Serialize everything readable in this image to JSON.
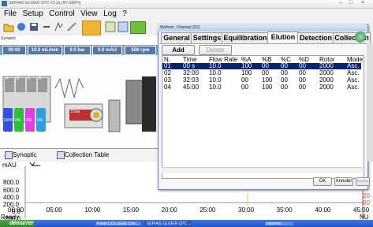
{
  "window": {
    "title": "SEPIAlS GLIDER CPC V3.2a (IFI-SEPH)"
  },
  "menu": [
    "File",
    "Setup",
    "Control",
    "View",
    "Log",
    "?"
  ],
  "synoptic": {
    "label": "Synoptic",
    "status_chips": [
      "00:00",
      "10.0 mL/min",
      "0.0 bar",
      "0.0 mAU",
      "500 rpm"
    ],
    "bottles": [
      "A",
      "B",
      "C",
      "D"
    ],
    "bottle_values": [
      "100%",
      "0%",
      "0%",
      "0%"
    ],
    "column_label": "0 bar"
  },
  "view_tabs": [
    {
      "label": "Synoptic"
    },
    {
      "label": "Collection Table"
    }
  ],
  "chart_data": {
    "type": "line",
    "ylabel": "mAU",
    "y_ticks": [
      "800.0",
      "600.0",
      "400.0",
      "200.0",
      "0.0",
      "-200.0"
    ],
    "x_ticks": [
      "00:00",
      "05:00",
      "10:00",
      "15:00",
      "20:00",
      "25:00",
      "30:00",
      "35:00",
      "40:00",
      "45:00"
    ],
    "ylim": [
      -200,
      800
    ],
    "xlim": [
      0,
      45
    ],
    "right_axis_ticks": [
      "20",
      "00"
    ],
    "series": [
      {
        "values": []
      }
    ]
  },
  "status": {
    "left": "Ready",
    "right": "NU"
  },
  "taskbar": {
    "start": "démarrer",
    "tasks": [
      "Poste COLLEGE Che...",
      "SEPIAlS GLIDER CPC ...",
      "copernic"
    ]
  },
  "dialog": {
    "title": "Method : Channel (D2)",
    "tabs": [
      "General",
      "Settings",
      "Equilibration",
      "Elution",
      "Detection",
      "Collection"
    ],
    "active_tab": "Elution",
    "add_label": "Add",
    "delete_label": "Delete",
    "ok_label": "OK",
    "cancel_label": "Annuler",
    "apply_label": "Appliquer",
    "columns": [
      "N.",
      "Time",
      "Flow Rate",
      "%A",
      "%B",
      "%C",
      "%D",
      "Rotor",
      "Mode"
    ],
    "rows": [
      [
        "01",
        "00 s",
        "10.0",
        "100",
        "00",
        "00",
        "00",
        "2000",
        "Asc."
      ],
      [
        "02",
        "32:00",
        "10.0",
        "100",
        "00",
        "00",
        "00",
        "2000",
        "Asc."
      ],
      [
        "03",
        "32:03",
        "10.0",
        "00",
        "100",
        "00",
        "00",
        "2000",
        "Asc."
      ],
      [
        "04",
        "45:00",
        "10.0",
        "00",
        "100",
        "00",
        "00",
        "2000",
        "Asc."
      ]
    ],
    "selected_row": 0
  },
  "colors": {
    "accent": "#0a246a",
    "taskbar": "#2a62d8",
    "start": "#3c9a34",
    "trace_axis": "#ff3030"
  }
}
